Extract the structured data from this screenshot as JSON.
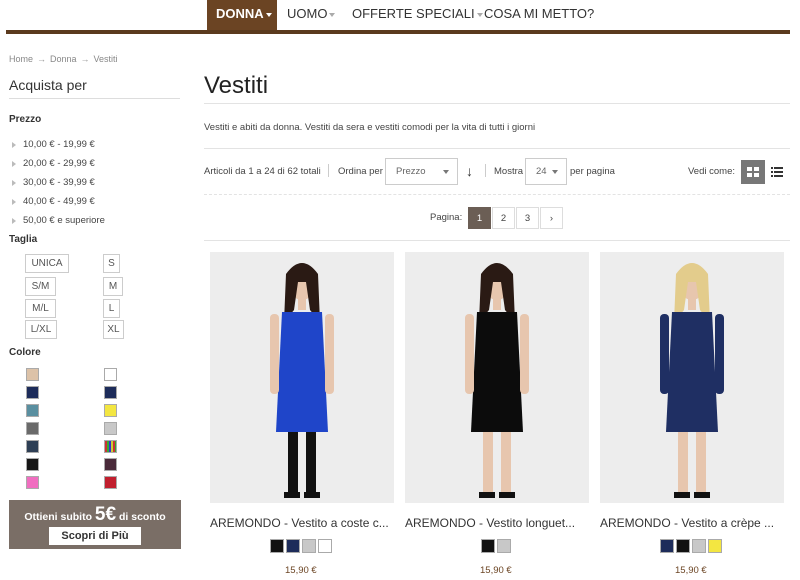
{
  "nav": {
    "items": [
      {
        "label": "DONNA",
        "active": true
      },
      {
        "label": "UOMO"
      },
      {
        "label": "OFFERTE SPECIALI"
      },
      {
        "label": "COSA MI METTO?"
      }
    ]
  },
  "breadcrumb": [
    "Home",
    "Donna",
    "Vestiti"
  ],
  "sidebar": {
    "title": "Acquista per",
    "price_heading": "Prezzo",
    "prices": [
      "10,00 € - 19,99 €",
      "20,00 € - 29,99 €",
      "30,00 € - 39,99 €",
      "40,00 € - 49,99 €",
      "50,00 € e superiore"
    ],
    "size_heading": "Taglia",
    "sizes": [
      "UNICA",
      "S",
      "S/M",
      "M",
      "M/L",
      "L",
      "L/XL",
      "XL"
    ],
    "color_heading": "Colore",
    "colors": [
      "#dcc2a8",
      "#ffffff",
      "#1d2c5a",
      "#1d2c5a",
      "#5a8fa0",
      "#f3e641",
      "#6a6a6a",
      "#c8c8c8",
      "#2e3f55",
      "#9a7b4f",
      "#161616",
      "#4a2a3a",
      "#f06ec0",
      "#c11f2e"
    ]
  },
  "promo": {
    "prefix": "Ottieni subito",
    "amount": "5€",
    "suffix": "di sconto",
    "button": "Scopri di Più"
  },
  "main": {
    "title": "Vestiti",
    "description": "Vestiti e abiti da donna. Vestiti da sera e vestiti comodi per la vita di tutti i giorni",
    "count_text": "Articoli da 1 a 24 di 62 totali",
    "order_label": "Ordina per",
    "order_value": "Prezzo",
    "show_label": "Mostra",
    "show_value": "24",
    "per_page": "per pagina",
    "view_label": "Vedi come:",
    "pagination_label": "Pagina:",
    "pages": [
      "1",
      "2",
      "3"
    ],
    "next": "›"
  },
  "products": [
    {
      "name": "AREMONDO - Vestito a coste c...",
      "price": "15,90 €",
      "colors": [
        "#111111",
        "#1d2c5a",
        "#c8c8c8",
        "#ffffff"
      ],
      "dress": "#1f45c9"
    },
    {
      "name": "AREMONDO - Vestito longuet...",
      "price": "15,90 €",
      "colors": [
        "#111111",
        "#c8c8c8"
      ],
      "dress": "#0c0c0c"
    },
    {
      "name": "AREMONDO - Vestito a crèpe ...",
      "price": "15,90 €",
      "colors": [
        "#1d2c5a",
        "#111111",
        "#c8c8c8",
        "#f3e641"
      ],
      "dress": "#1f2f63"
    }
  ]
}
